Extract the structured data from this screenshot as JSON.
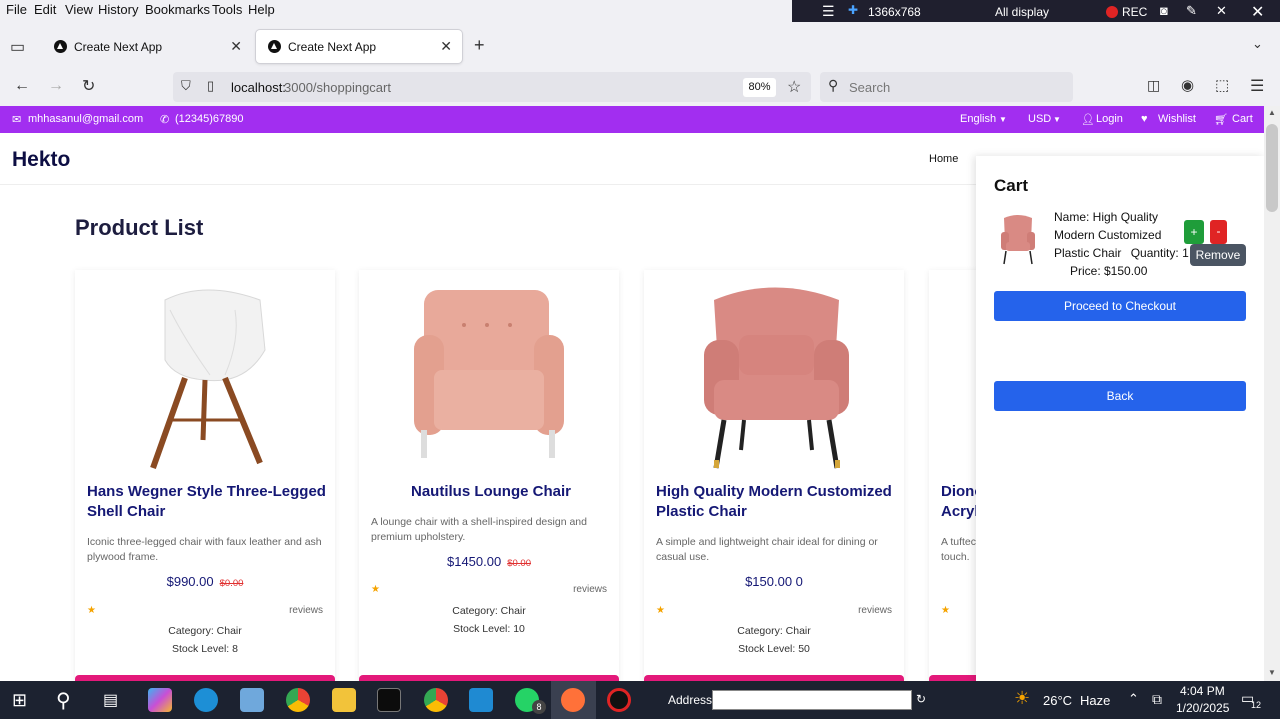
{
  "browser": {
    "menu": [
      "File",
      "Edit",
      "View",
      "History",
      "Bookmarks",
      "Tools",
      "Help"
    ],
    "recorder": {
      "resolution": "1366x768",
      "display": "All display",
      "rec": "REC"
    },
    "tabs": [
      {
        "title": "Create Next App"
      },
      {
        "title": "Create Next App"
      }
    ],
    "url_host": "localhost:",
    "url_path": "3000/shoppingcart",
    "zoom": "80%",
    "search_placeholder": "Search"
  },
  "site": {
    "email": "mhhasanul@gmail.com",
    "phone": "(12345)67890",
    "language": "English",
    "currency": "USD",
    "login": "Login",
    "wishlist": "Wishlist",
    "cart_link": "Cart",
    "brand": "Hekto",
    "nav_home": "Home",
    "product_list_title": "Product List"
  },
  "products": [
    {
      "name": "Hans Wegner Style Three-Legged Shell Chair",
      "description": "Iconic three-legged chair with faux leather and ash plywood frame.",
      "price": "$990.00",
      "old_price": "$0.00",
      "star": "★",
      "reviews": "reviews",
      "category": "Category: Chair",
      "stock": "Stock Level: 8"
    },
    {
      "name": "Nautilus Lounge Chair",
      "description": "A lounge chair with a shell-inspired design and premium upholstery.",
      "price": "$1450.00",
      "old_price": "$0.00",
      "star": "★",
      "reviews": "reviews",
      "category": "Category: Chair",
      "stock": "Stock Level: 10"
    },
    {
      "name": "High Quality Modern Customized Plastic Chair",
      "description": "A simple and lightweight chair ideal for dining or casual use.",
      "price": "$150.00 0",
      "star": "★",
      "reviews": "reviews",
      "category": "Category: Chair",
      "stock": "Stock Level: 50"
    },
    {
      "name": "Dionc Acryl",
      "description": "A tuftec touch.",
      "star": "★"
    }
  ],
  "cart": {
    "title": "Cart",
    "item_name": "Name: High Quality Modern Customized Plastic Chair",
    "quantity_label": "Quantity:",
    "quantity": "1",
    "price": "Price: $150.00",
    "plus": "+",
    "minus": "-",
    "tooltip": "Remove",
    "checkout": "Proceed to Checkout",
    "back": "Back"
  },
  "taskbar": {
    "address_label": "Address",
    "weather_temp": "26°C",
    "weather_desc": "Haze",
    "time": "4:04 PM",
    "date": "1/20/2025",
    "whatsapp_badge": "8",
    "notif_count": "12"
  },
  "colors": {
    "accent_purple": "#a22ef0",
    "brand_navy": "#0d0e43",
    "pink_button": "#e3197a",
    "blue_button": "#2563eb"
  }
}
